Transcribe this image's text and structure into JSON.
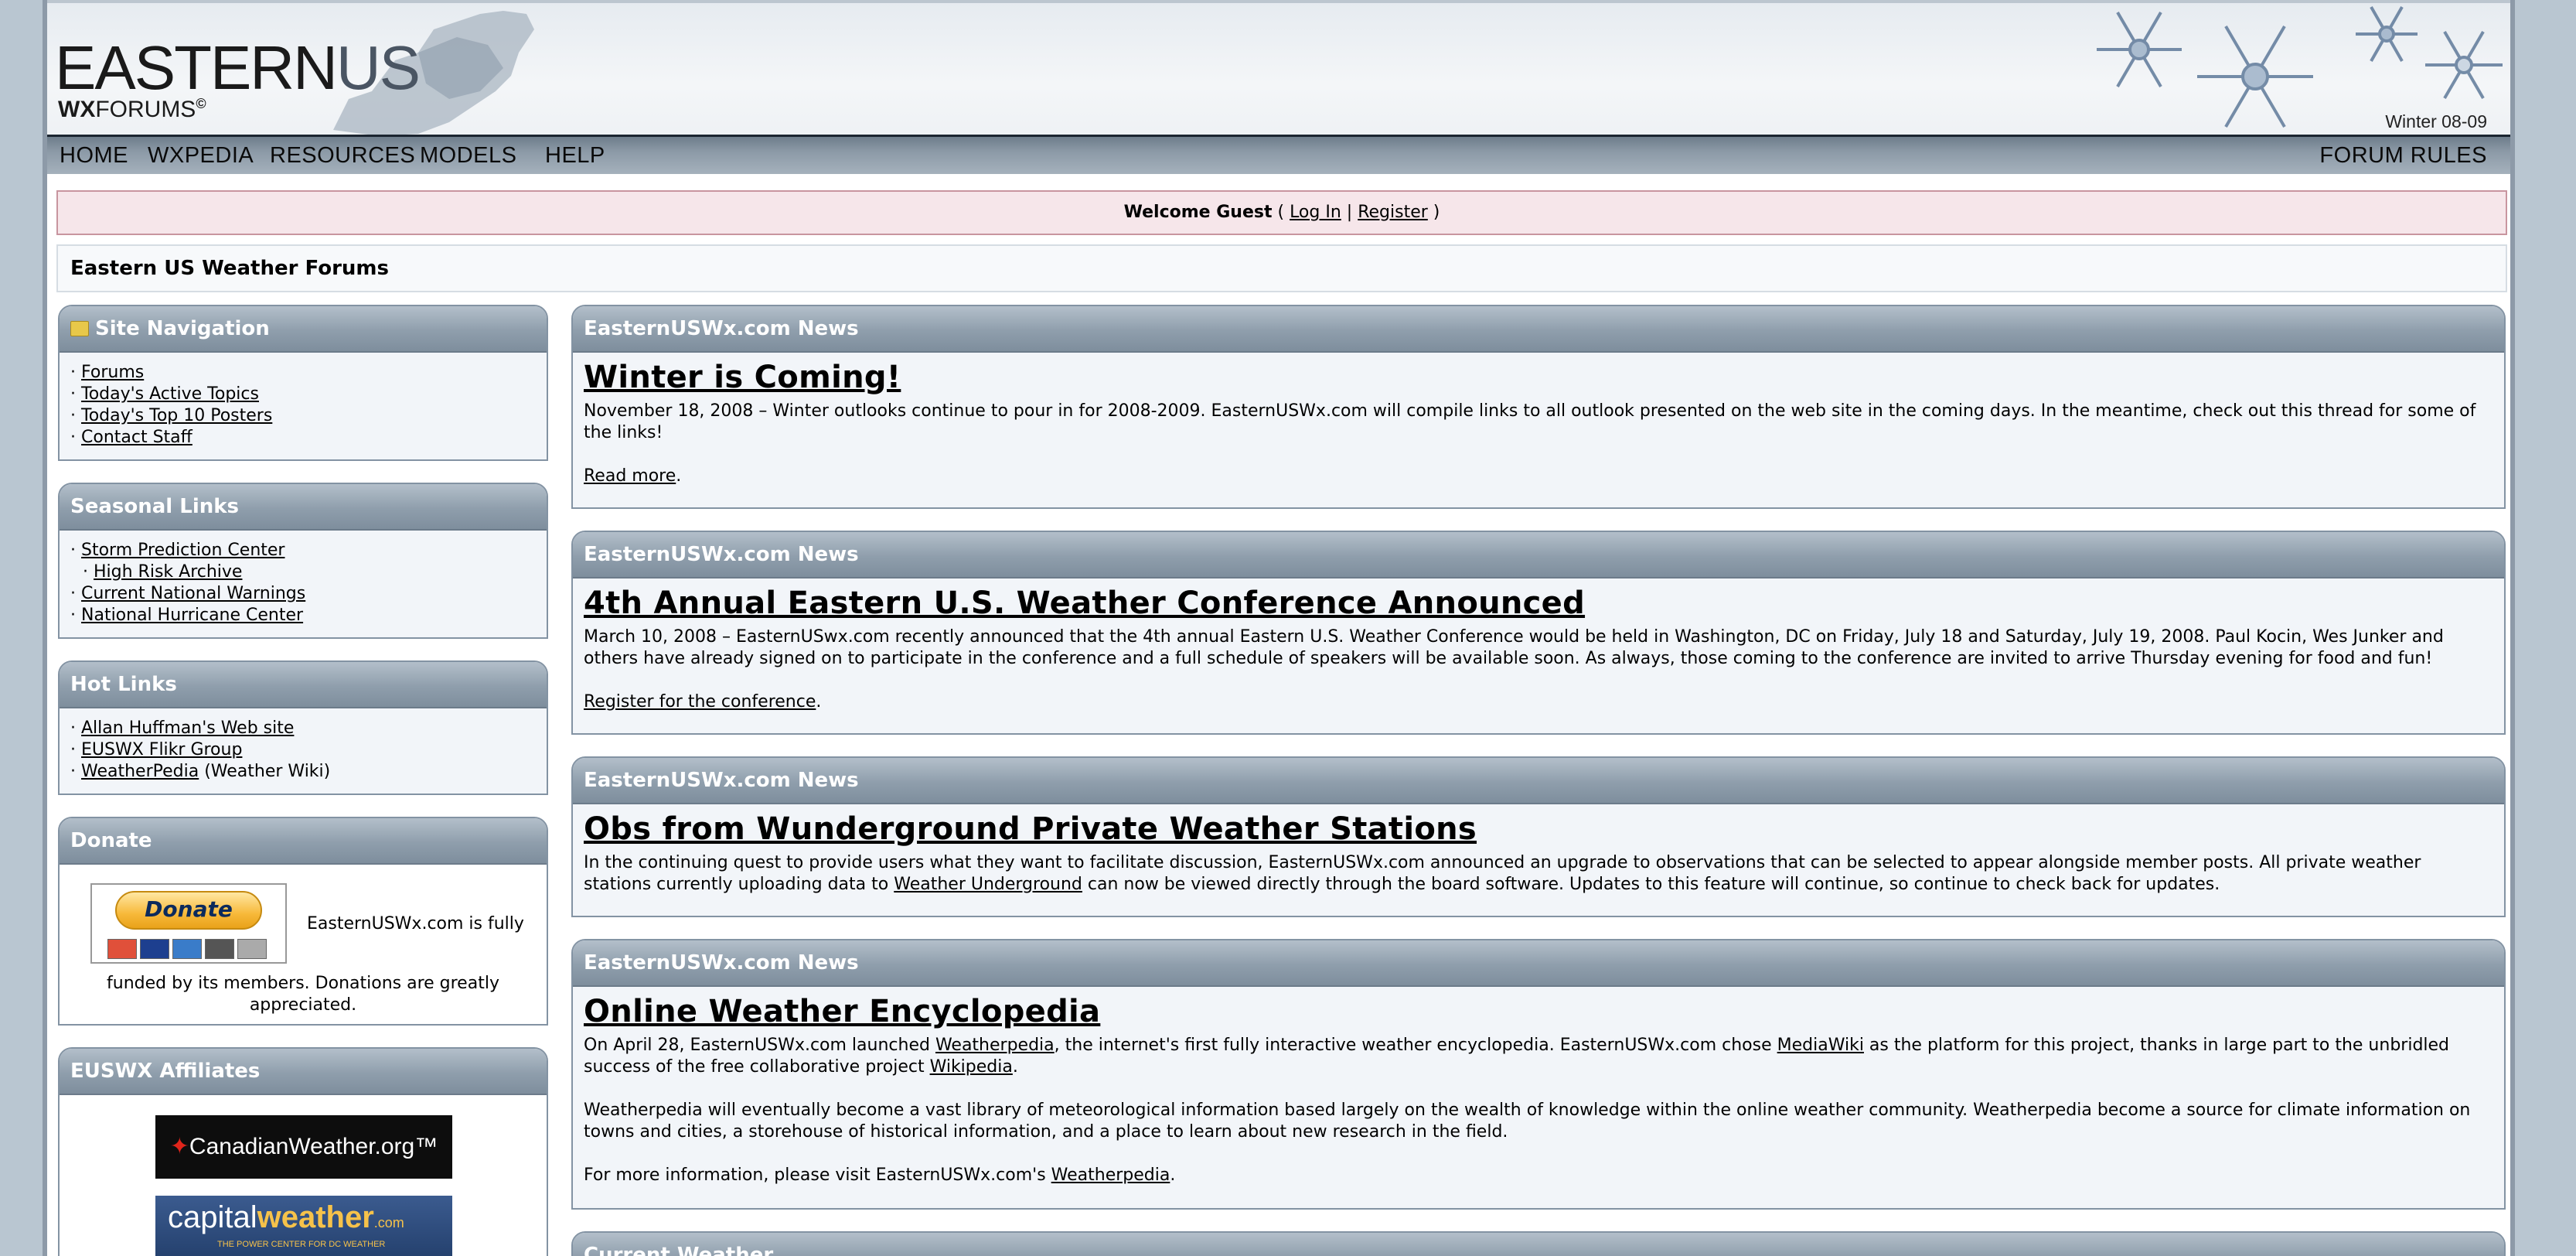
{
  "header": {
    "logo_main": "EASTERN",
    "logo_us": "US",
    "logo_sub_bold": "WX",
    "logo_sub": "FORUMS",
    "logo_mark": "©",
    "season": "Winter 08-09"
  },
  "nav": {
    "items": [
      "HOME",
      "WXPEDIA",
      "RESOURCES",
      "MODELS",
      "HELP"
    ],
    "rules": "FORUM RULES"
  },
  "welcome": {
    "text": "Welcome Guest",
    "open": " ( ",
    "login": "Log In",
    "sep": " | ",
    "register": "Register",
    "close": " )"
  },
  "forum_title": "Eastern US Weather Forums",
  "sidebar": {
    "site_nav": {
      "title": "Site Navigation",
      "items": [
        "Forums",
        "Today's Active Topics",
        "Today's Top 10 Posters",
        "Contact Staff"
      ]
    },
    "seasonal": {
      "title": "Seasonal Links",
      "items": [
        "Storm Prediction Center",
        "High Risk Archive",
        "Current National Warnings",
        "National Hurricane Center"
      ]
    },
    "hot": {
      "title": "Hot Links",
      "items": [
        "Allan Huffman's Web site",
        "EUSWX Flikr Group",
        "WeatherPedia"
      ],
      "weatherpedia_note": "(Weather Wiki)"
    },
    "donate": {
      "title": "Donate",
      "button": "Donate",
      "text1": "EasternUSWx.com is fully",
      "text2": "funded by its members. Donations are greatly",
      "text3": "appreciated."
    },
    "affiliates": {
      "title": "EUSWX Affiliates",
      "a1": "CanadianWeather.org™",
      "a2_1": "capital",
      "a2_2": "weather",
      "a2_3": ".com",
      "a2_tag": "THE POWER CENTER FOR DC WEATHER"
    }
  },
  "news": [
    {
      "header": "EasternUSWx.com News",
      "title": "Winter is Coming!",
      "p1": "November 18, 2008 – Winter outlooks continue to pour in for 2008-2009. EasternUSWx.com will compile links to all outlook presented on the web site in the coming days. In the meantime, check out this thread for some of the links!",
      "link": "Read more",
      "link_tail": "."
    },
    {
      "header": "EasternUSWx.com News",
      "title": "4th Annual Eastern U.S. Weather Conference Announced",
      "p1": "March 10, 2008 – EasternUSwx.com recently announced that the 4th annual Eastern U.S. Weather Conference would be held in Washington, DC on Friday, July 18 and Saturday, July 19, 2008. Paul Kocin, Wes Junker and others have already signed on to participate in the conference and a full schedule of speakers will be available soon. As always, those coming to the conference are invited to arrive Thursday evening for food and fun!",
      "link": "Register for the conference",
      "link_tail": "."
    },
    {
      "header": "EasternUSWx.com News",
      "title": "Obs from Wunderground Private Weather Stations",
      "p1a": "In the continuing quest to provide users what they want to facilitate discussion, EasternUSWx.com announced an upgrade to observations that can be selected to appear alongside member posts. All private weather stations currently uploading data to ",
      "p1link": "Weather Underground",
      "p1b": " can now be viewed directly through the board software. Updates to this feature will continue, so continue to check back for updates."
    },
    {
      "header": "EasternUSWx.com News",
      "title": "Online Weather Encyclopedia",
      "p1a": "On April 28, EasternUSWx.com launched ",
      "p1l1": "Weatherpedia",
      "p1b": ", the internet's first fully interactive weather encyclopedia. EasternUSWx.com chose ",
      "p1l2": "MediaWiki",
      "p1c": " as the platform for this project, thanks in large part to the unbridled success of the free collaborative project ",
      "p1l3": "Wikipedia",
      "p1d": ".",
      "p2": "Weatherpedia will eventually become a vast library of meteorological information based largely on the wealth of knowledge within the online weather community. Weatherpedia become a source for climate information on towns and cities, a storehouse of historical information, and a place to learn about new research in the field.",
      "p3a": "For more information, please visit EasternUSWx.com's ",
      "p3l": "Weatherpedia",
      "p3b": "."
    },
    {
      "header": "Current Weather"
    }
  ]
}
